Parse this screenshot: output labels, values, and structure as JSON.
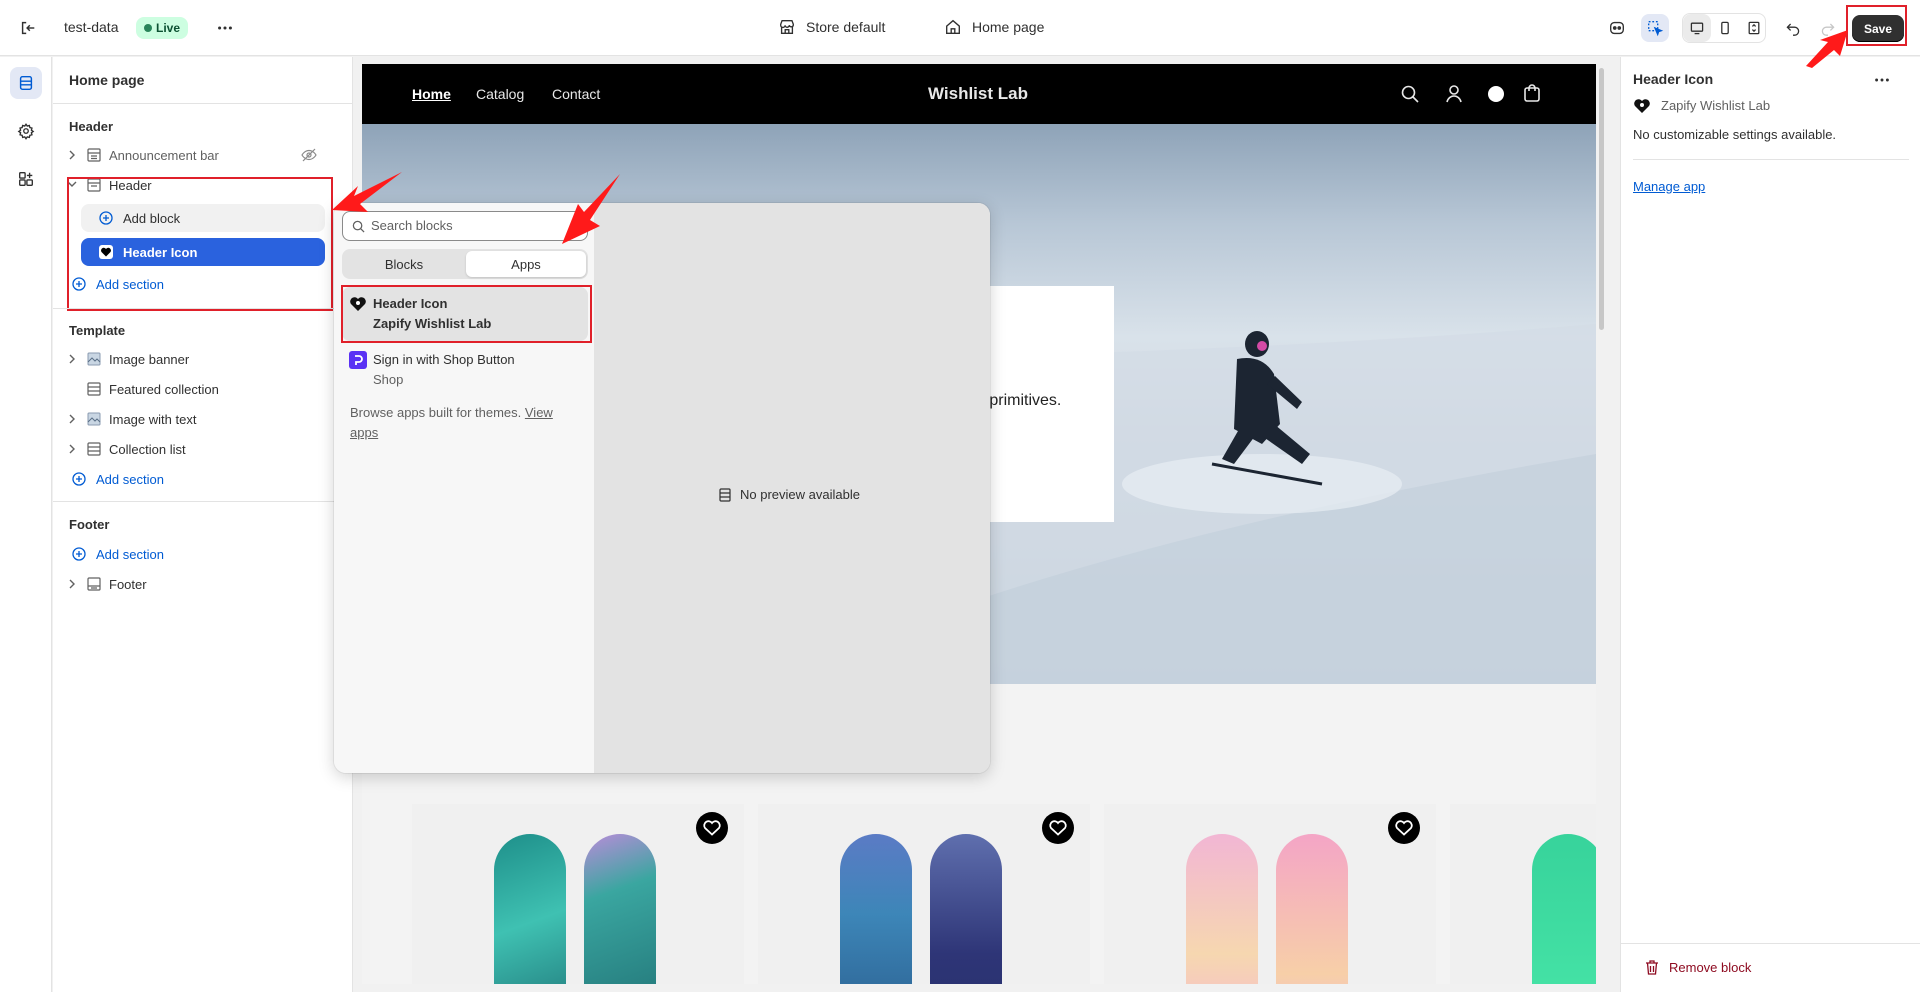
{
  "topbar": {
    "store_name": "test-data",
    "status": "Live",
    "theme_selector": "Store default",
    "page_selector": "Home page",
    "save_label": "Save"
  },
  "left_panel": {
    "title": "Home page",
    "header_group": "Header",
    "header_items": [
      {
        "label": "Announcement bar"
      },
      {
        "label": "Header"
      }
    ],
    "add_block": "Add block",
    "header_icon_block": "Header Icon",
    "add_section": "Add section",
    "template_group": "Template",
    "template_items": [
      {
        "label": "Image banner"
      },
      {
        "label": "Featured collection"
      },
      {
        "label": "Image with text"
      },
      {
        "label": "Collection list"
      }
    ],
    "footer_group": "Footer",
    "footer_items": [
      {
        "label": "Footer"
      }
    ]
  },
  "store": {
    "nav": [
      "Home",
      "Catalog",
      "Contact"
    ],
    "brand": "Wishlist Lab",
    "hero_text_fragment": "e primitives."
  },
  "popup": {
    "search_placeholder": "Search blocks",
    "tabs": [
      "Blocks",
      "Apps"
    ],
    "active_tab": "Apps",
    "apps": [
      {
        "title": "Header Icon",
        "subtitle": "Zapify Wishlist Lab"
      },
      {
        "title": "Sign in with Shop Button",
        "subtitle": "Shop"
      }
    ],
    "browse_text": "Browse apps built for themes.",
    "browse_link": "View apps",
    "no_preview": "No preview available"
  },
  "right_panel": {
    "title": "Header Icon",
    "app_name": "Zapify Wishlist Lab",
    "note": "No customizable settings available.",
    "manage_link": "Manage app",
    "remove_label": "Remove block"
  },
  "colors": {
    "accent_blue": "#005bd3",
    "selected_blue": "#2a62de",
    "annotation_red": "#e0202a",
    "live_green": "#cdfee1"
  }
}
